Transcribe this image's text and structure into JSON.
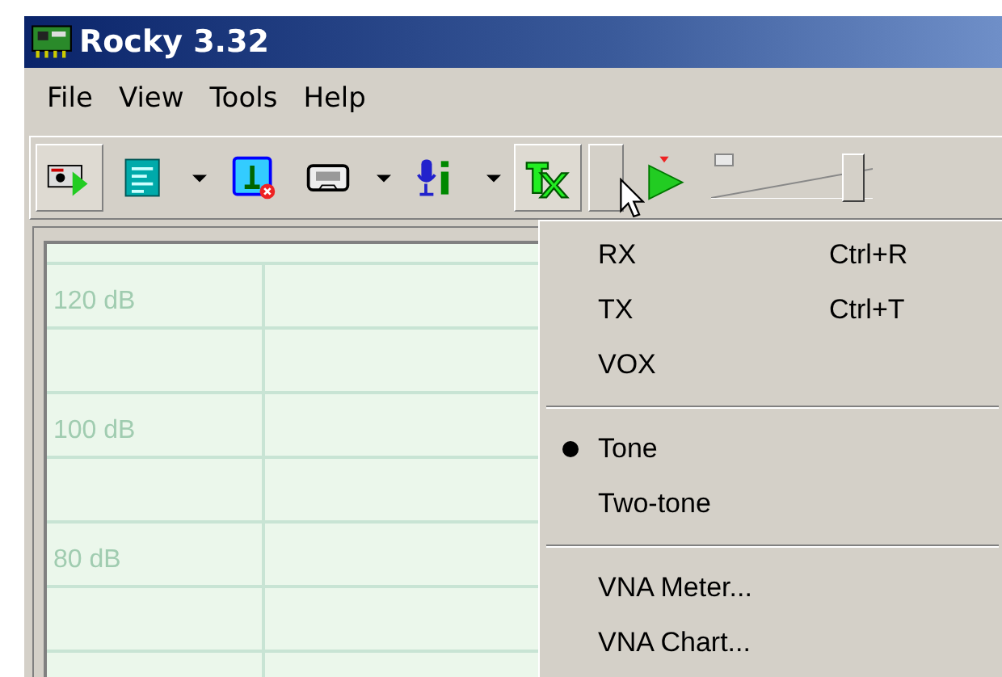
{
  "window": {
    "title": "Rocky 3.32"
  },
  "menu_bar": [
    "File",
    "View",
    "Tools",
    "Help"
  ],
  "toolbar": {
    "buttons": [
      {
        "pressed": true,
        "dropdown": false
      },
      {
        "pressed": false,
        "dropdown": true
      },
      {
        "pressed": false,
        "dropdown": false
      },
      {
        "pressed": false,
        "dropdown": true
      },
      {
        "pressed": false,
        "dropdown": true
      },
      {
        "pressed": true,
        "dropdown": false
      },
      {
        "pressed": false,
        "dropdown": false
      }
    ],
    "volume": {
      "level": 0.88
    }
  },
  "spectrum": {
    "scale_labels": [
      "120 dB",
      "100 dB",
      "80 dB"
    ]
  },
  "dropdown_menu": {
    "groups": [
      [
        {
          "label": "RX",
          "shortcut": "Ctrl+R",
          "checked": false
        },
        {
          "label": "TX",
          "shortcut": "Ctrl+T",
          "checked": false
        },
        {
          "label": "VOX",
          "checked": false
        }
      ],
      [
        {
          "label": "Tone",
          "checked": true
        },
        {
          "label": "Two-tone",
          "checked": false
        }
      ],
      [
        {
          "label": "VNA Meter...",
          "checked": false
        },
        {
          "label": "VNA Chart...",
          "checked": false
        }
      ]
    ]
  }
}
